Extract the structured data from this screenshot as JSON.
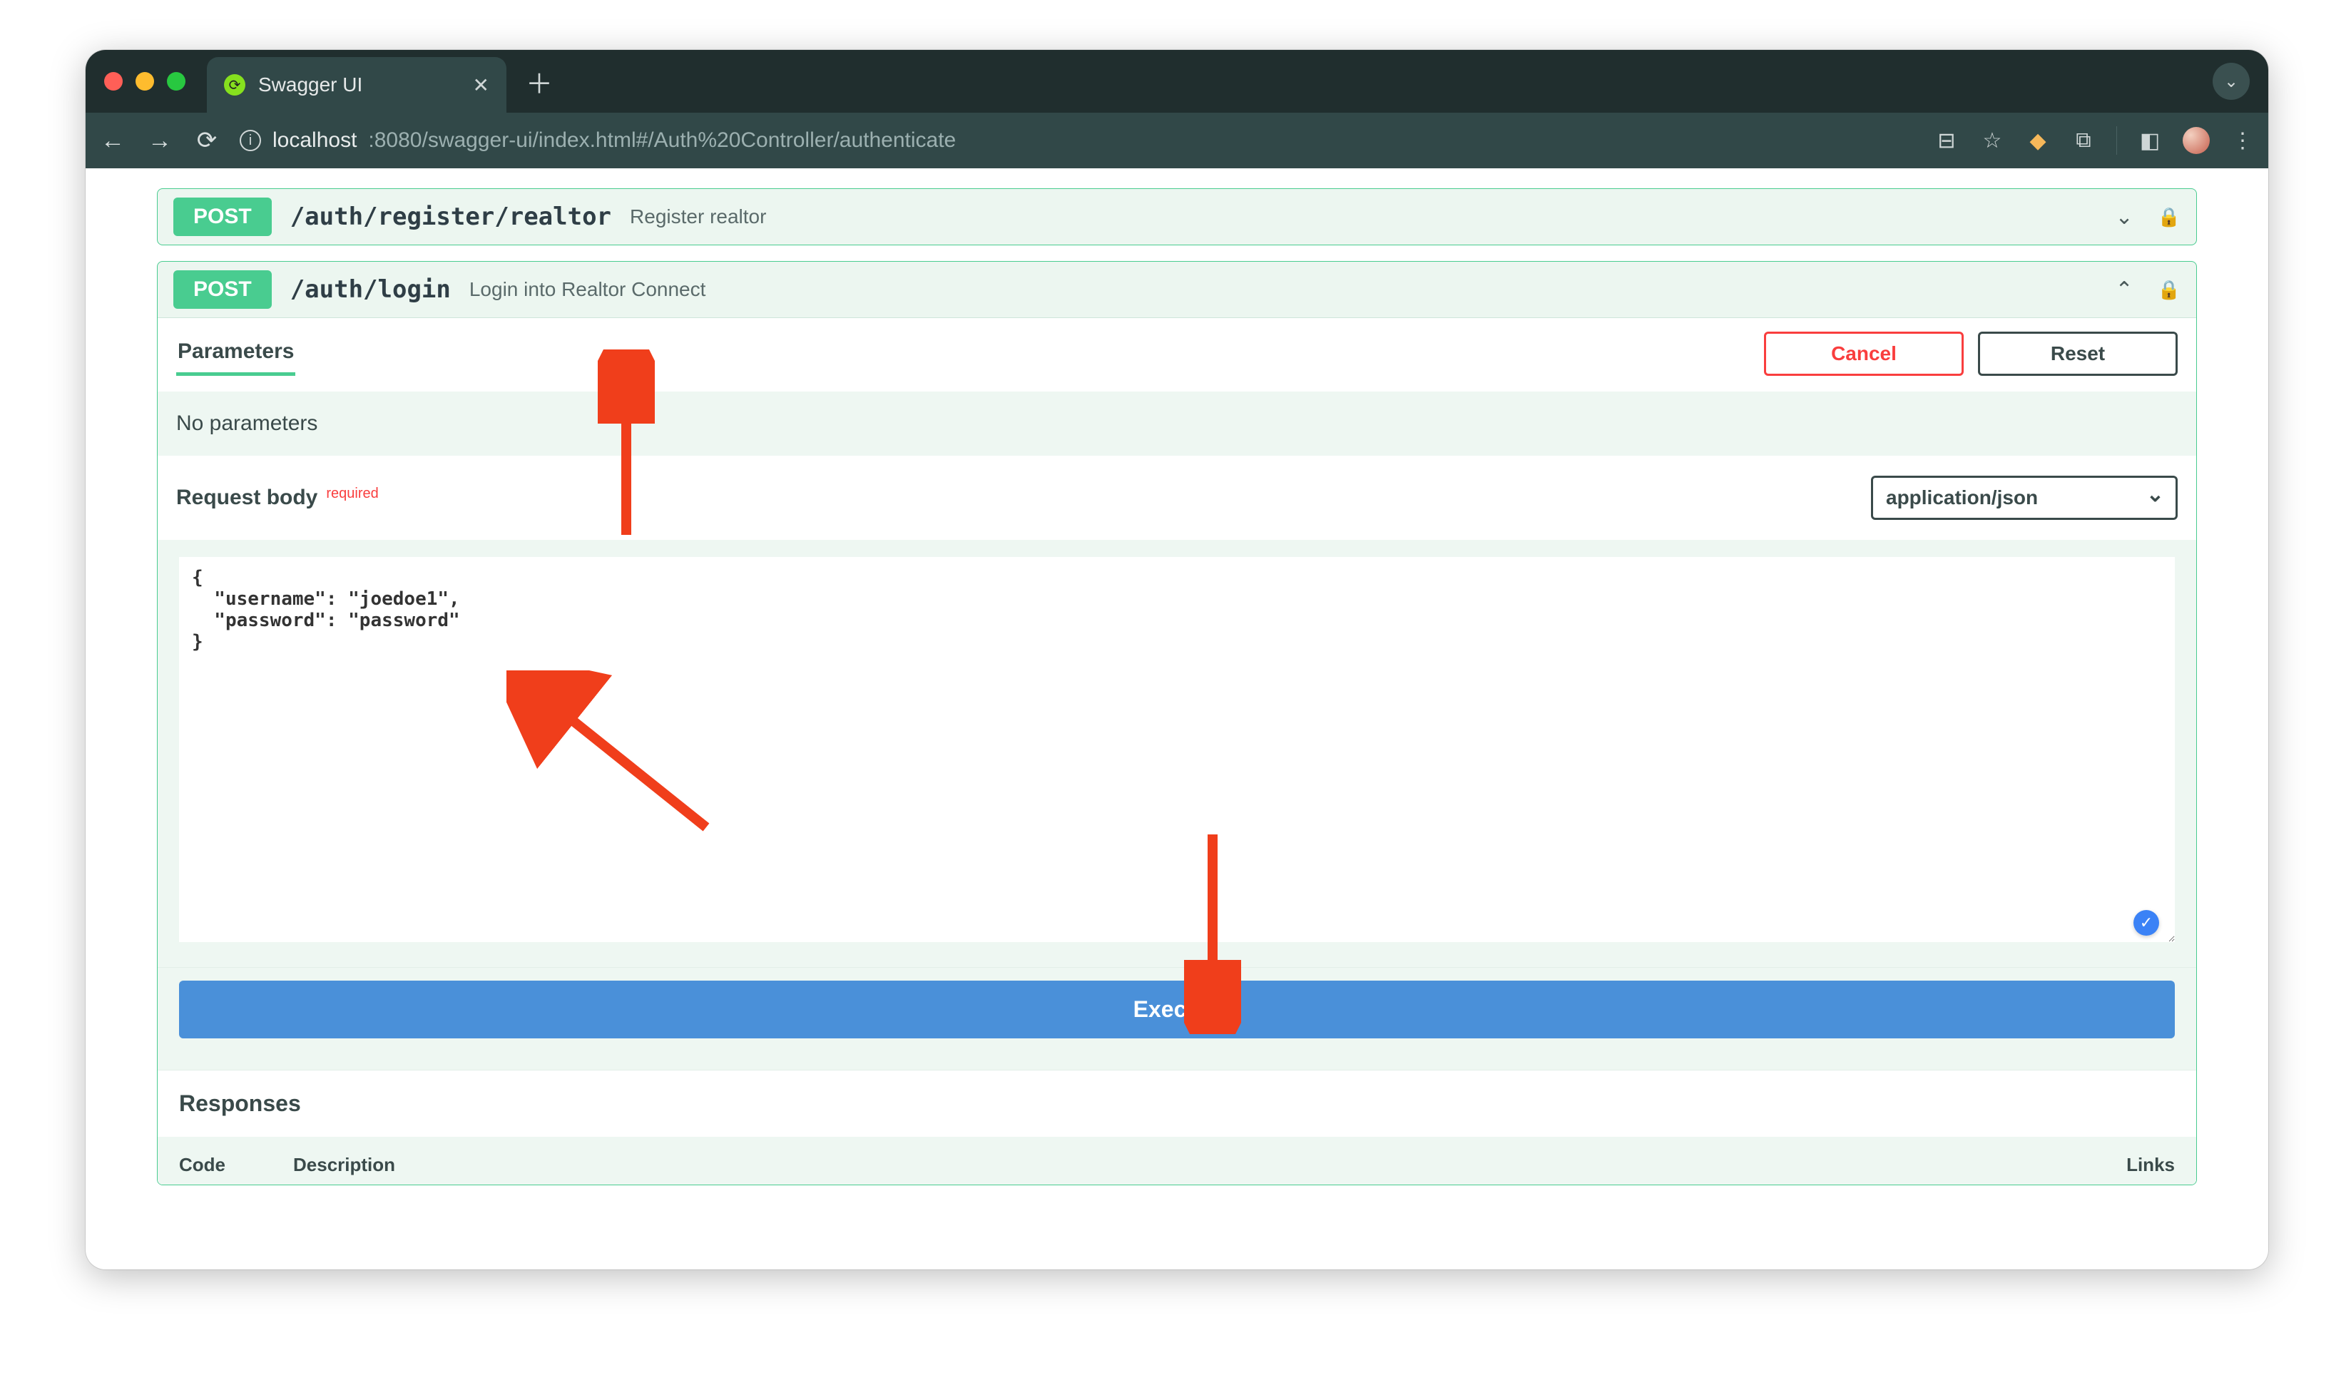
{
  "browser": {
    "tab_title": "Swagger UI",
    "url_host": "localhost",
    "url_portpath": ":8080/swagger-ui/index.html#/Auth%20Controller/authenticate"
  },
  "endpoints": [
    {
      "method": "POST",
      "path": "/auth/register/realtor",
      "description": "Register realtor",
      "expanded": false
    },
    {
      "method": "POST",
      "path": "/auth/login",
      "description": "Login into Realtor Connect",
      "expanded": true
    }
  ],
  "parameters_tab": "Parameters",
  "cancel_label": "Cancel",
  "reset_label": "Reset",
  "no_parameters": "No parameters",
  "request_body_label": "Request body",
  "required_label": "required",
  "content_type": "application/json",
  "request_body_value": "{\n  \"username\": \"joedoe1\",\n  \"password\": \"password\"\n}",
  "execute_label": "Execute",
  "responses_label": "Responses",
  "response_columns": {
    "code": "Code",
    "description": "Description",
    "links": "Links"
  }
}
